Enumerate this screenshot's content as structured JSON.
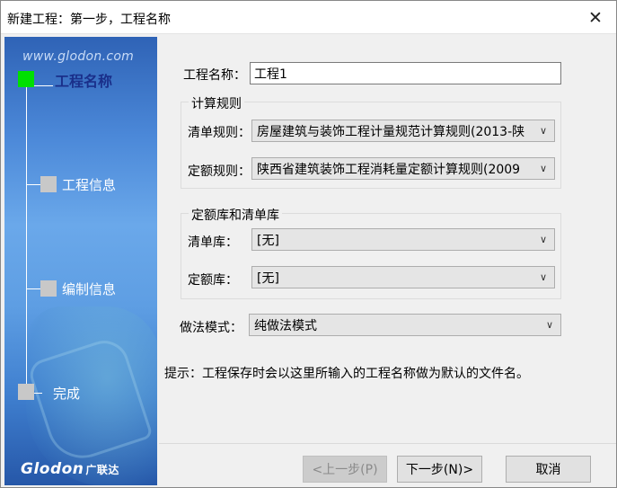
{
  "window": {
    "title": "新建工程：第一步，工程名称",
    "close_glyph": "✕"
  },
  "side": {
    "site": "www.glodon.com",
    "brand": "Glodon",
    "brand_cn": "广联达",
    "steps": [
      {
        "label": "工程名称",
        "active": true
      },
      {
        "label": "工程信息",
        "active": false
      },
      {
        "label": "编制信息",
        "active": false
      },
      {
        "label": "完成",
        "active": false
      }
    ],
    "colors": {
      "active_square": "#00e000",
      "inactive_square": "#c8c8c8",
      "panel_blue": "#4b88d8"
    }
  },
  "form": {
    "project_name_label": "工程名称：",
    "project_name_value": "工程1",
    "calc_rules_group": "计算规则",
    "bill_rule_label": "清单规则：",
    "bill_rule_value": "房屋建筑与装饰工程计量规范计算规则(2013-陕",
    "quota_rule_label": "定额规则：",
    "quota_rule_value": "陕西省建筑装饰工程消耗量定额计算规则(2009",
    "library_group": "定额库和清单库",
    "bill_lib_label": "清单库：",
    "bill_lib_value": "[无]",
    "quota_lib_label": "定额库：",
    "quota_lib_value": "[无]",
    "method_label": "做法模式：",
    "method_value": "纯做法模式",
    "hint": "提示：工程保存时会以这里所输入的工程名称做为默认的文件名。"
  },
  "buttons": {
    "prev": "<上一步(P)",
    "next": "下一步(N)>",
    "cancel": "取消"
  }
}
